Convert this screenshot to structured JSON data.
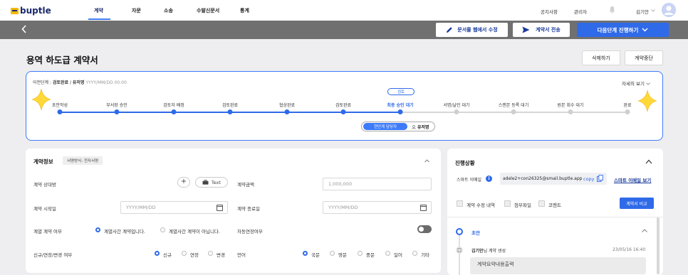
{
  "nav": {
    "logo": "buptle",
    "items": [
      "계약",
      "자문",
      "소송",
      "수발신문서",
      "통계"
    ],
    "right_links": [
      "공지사항",
      "관리자"
    ],
    "user_name": "김기안"
  },
  "actionbar": {
    "edit_web": "문서를 웹에서 수정",
    "send_contract": "계약서 전송",
    "next_step": "다음단계 진행하기"
  },
  "page": {
    "title": "용역 하도급 계약서",
    "delete_btn": "삭제하기",
    "stop_btn": "계약중단"
  },
  "progress": {
    "prev_stage_label": "이전단계 :",
    "prev_stage": "검토완료",
    "sep": "/",
    "person": "유저명",
    "date_placeholder": "YYYY/MM/DD 00:00",
    "detail_toggle": "자세히 보기",
    "review_pill": "검토",
    "steps": [
      "초안작성",
      "부서장 승인",
      "검토자 배정",
      "검토완료",
      "협상완료",
      "검토완료",
      "최종 승인 대기",
      "서명/날인 대기",
      "스캔본 등록 대기",
      "원본 회수 대기",
      "완료"
    ],
    "current_index": 6,
    "assignee_label": "현단계 담당자",
    "assignee_name": "유저명"
  },
  "contract_info": {
    "title": "계약정보",
    "sign_method": "서명방식: 전자서명",
    "party_label": "계약 상대방",
    "text_btn": "Text",
    "amount_label": "계약금액",
    "amount_placeholder": "1,000,000",
    "start_label": "계약 시작일",
    "start_placeholder": "YYYY/MM/DD",
    "end_label": "계약 종료일",
    "end_placeholder": "YYYY/MM/DD",
    "affiliate_label": "계열 계약 여부",
    "affiliate_yes": "계열사간 계약입니다.",
    "affiliate_no": "계열사간 계약이 아닙니다.",
    "auto_renew_label": "자동연장여부",
    "type_label": "신규/연장/변경 여부",
    "type_options": [
      "신규",
      "연장",
      "변경"
    ],
    "language_label": "언어",
    "language_options": [
      "국문",
      "영문",
      "중문",
      "일어",
      "기타"
    ]
  },
  "status": {
    "title": "진행상황",
    "smart_email_label": "스마트 이메일",
    "email": "adele2+con26325@smail.buptle.app",
    "copy": "copy",
    "view_smart_email": "스마트 이메일 보기",
    "filters": [
      "계약 수정 내역",
      "첨부파일",
      "코멘트"
    ],
    "compare_btn": "계약서 비교",
    "timeline_title": "초안",
    "event_user": "김기안",
    "event_text": "님 계약 생성",
    "event_time": "23/05/16 16:40",
    "event_box": "계약요약내용출력"
  },
  "colors": {
    "accent": "#2f6ae8",
    "dark_bar": "#707070",
    "logo_yellow": "#f5b800",
    "navy": "#1a2a6c",
    "inactive_dot": "#cfcfcf"
  }
}
